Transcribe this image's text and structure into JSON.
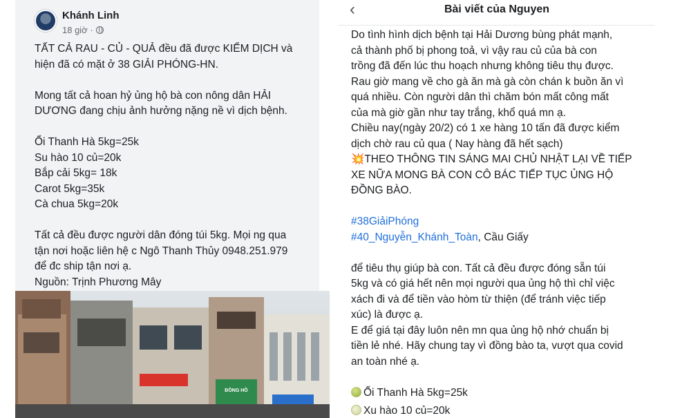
{
  "left_post": {
    "author": "Khánh Linh",
    "time": "18 giờ ·",
    "paragraphs": [
      [
        "TẤT CẢ RAU - CỦ - QUẢ đều đã được KIỂM DỊCH và",
        "hiện đã có mặt ở 38 GIẢI PHÓNG-HN."
      ],
      [
        "Mong tất cả hoan hỷ ủng hộ bà con nông dân HẢI",
        "DƯƠNG đang chịu ảnh hưởng nặng nề vì dịch bệnh."
      ],
      [
        "Ổi Thanh Hà 5kg=25k",
        "Su hào 10 củ=20k",
        "Bắp cải 5kg= 18k",
        "Carot 5kg=35k",
        "Cà chua 5kg=20k"
      ],
      [
        "Tất cả đều được người dân đóng túi 5kg. Mọi ng qua",
        "tận nơi hoặc liên hệ c Ngô Thanh Thủy 0948.251.979",
        "để đc ship tận nơi ạ.",
        "Nguồn: Trịnh Phương Mây"
      ]
    ],
    "shop_sign": "ĐỒNG HỒ"
  },
  "right_post": {
    "back_icon": "chevron-left-icon",
    "title": "Bài viết của Nguyen",
    "intro_lines": [
      "Do tình hình dịch bệnh tại Hải Dương bùng phát mạnh,",
      "cả thành phố bị phong toả, vì vậy rau củ của bà con",
      "trồng đã đến lúc thu hoạch nhưng không tiêu thụ được.",
      "Rau giờ mang về cho gà ăn mà gà còn chán k buồn ăn vì",
      "quá nhiều. Còn người dân thì chăm bón mất công mất",
      "của mà giờ gần như tay trắng, khổ quá mn ạ.",
      "Chiều nay(ngày 20/2) có 1 xe hàng 10 tấn đã được kiểm",
      "dịch chờ rau củ qua ( Nay hàng đã hết sạch)"
    ],
    "alert_emoji": "💥",
    "alert_lines": [
      "THEO THÔNG TIN SÁNG MAI CHỦ NHẬT LẠI VỀ TIẾP",
      "XE NỮA MONG BÀ CON CÔ BÁC TIẾP TỤC ỦNG HỘ",
      "ĐỒNG BÀO."
    ],
    "hashtag_1": "#38GiảiPhóng",
    "hashtag_2": "#40_Nguyễn_Khánh_Toàn",
    "location_suffix": ", Cầu Giấy",
    "body_lines": [
      " để tiêu thụ giúp bà con. Tất cả đều được đóng sẵn túi",
      "5kg và có giá hết nên mọi người qua ủng hộ thì chỉ việc",
      "xách đi và để tiền vào hòm từ thiện (để tránh việc tiếp",
      "xúc) là được ạ.",
      "E để giá tại đây luôn nên mn qua ủng hộ nhớ chuẩn bị",
      "tiền lẻ nhé. Hãy chung tay vì đồng bào ta, vượt qua covid",
      "an toàn nhé ạ."
    ],
    "price_1": "Ổi Thanh Hà 5kg=25k",
    "price_2": "Xu hào 10 củ=20k"
  }
}
